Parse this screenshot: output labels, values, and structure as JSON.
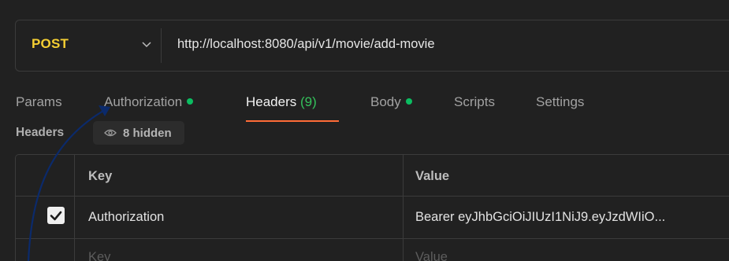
{
  "request": {
    "method": "POST",
    "url": "http://localhost:8080/api/v1/movie/add-movie"
  },
  "tabs": [
    {
      "label": "Params",
      "dot": false
    },
    {
      "label": "Authorization",
      "dot": true
    },
    {
      "label": "Headers",
      "count": "(9)",
      "active": true
    },
    {
      "label": "Body",
      "dot": true
    },
    {
      "label": "Scripts"
    },
    {
      "label": "Settings"
    }
  ],
  "headers_section": {
    "title": "Headers",
    "hidden_label": "8 hidden"
  },
  "table": {
    "columns": [
      "Key",
      "Value"
    ],
    "rows": [
      {
        "checked": true,
        "key": "Authorization",
        "value": "Bearer eyJhbGciOiJIUzI1NiJ9.eyJzdWIiO..."
      }
    ],
    "placeholder_key": "Key",
    "placeholder_value": "Value"
  },
  "colors": {
    "method": "#f5cf33",
    "active_underline": "#ff6c37",
    "status_dot": "#0bbd61",
    "count": "#34c15b",
    "annotation_arrow": "#0b2a6b"
  },
  "icons": {
    "method_dropdown": "chevron-down-icon",
    "hidden_toggle": "eye-icon",
    "row_checkbox": "checkmark-icon"
  }
}
